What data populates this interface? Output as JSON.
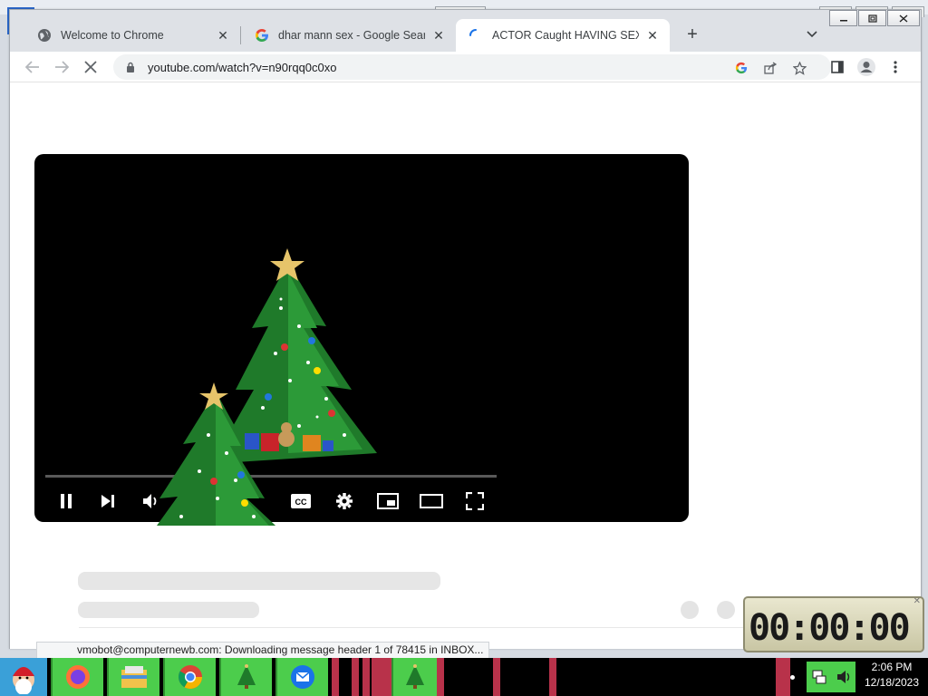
{
  "browser": {
    "tabs": [
      {
        "title": "Welcome to Chrome",
        "favicon": "globe-icon",
        "active": false
      },
      {
        "title": "dhar mann sex - Google Search",
        "favicon": "google-g-icon",
        "active": false
      },
      {
        "title": "ACTOR Caught HAVING SEX, Wh",
        "favicon": "loading-spinner-icon",
        "active": true
      }
    ],
    "new_tab": "+",
    "address": "youtube.com/watch?v=n90rqq0c0xo",
    "window_controls": [
      "minimize-icon",
      "restore-icon",
      "close-icon"
    ]
  },
  "player": {
    "controls": [
      "pause-icon",
      "next-icon",
      "volume-icon",
      "captions-icon",
      "settings-icon",
      "miniplayer-icon",
      "theater-icon",
      "fullscreen-icon"
    ],
    "cc_label": "CC"
  },
  "status_bar": {
    "text": "vmobot@computernewb.com: Downloading message header 1 of 78415 in INBOX..."
  },
  "gadget": {
    "time": "00:00:00"
  },
  "taskbar": {
    "apps": [
      "santa-start-icon",
      "firefox-icon",
      "file-explorer-icon",
      "chrome-icon",
      "christmas-tree-icon",
      "thunderbird-icon",
      "christmas-tree-icon"
    ],
    "clock_time": "2:06 PM",
    "clock_date": "12/18/2023"
  },
  "colors": {
    "tabstrip": "#dee1e6",
    "taskbar_app": "#4ccd4c",
    "accent": "#1a73e8"
  }
}
